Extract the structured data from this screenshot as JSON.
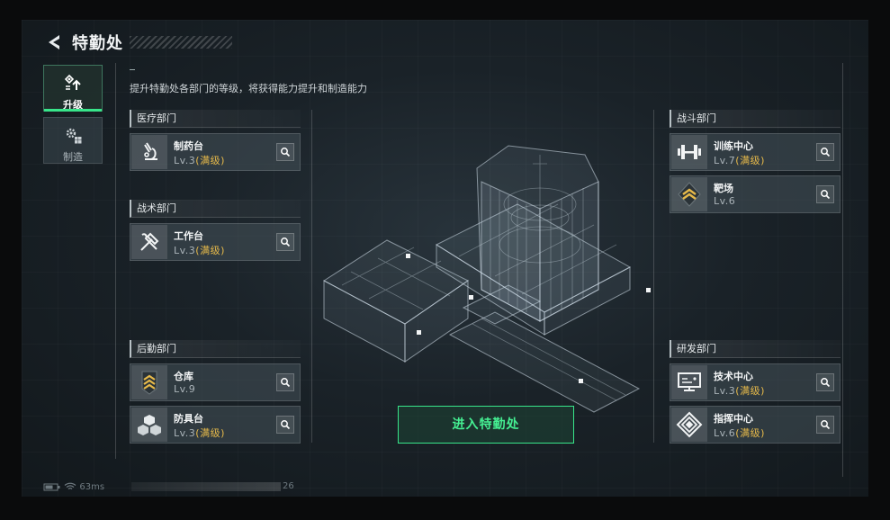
{
  "header": {
    "title": "特勤处"
  },
  "tabs": [
    {
      "label": "升级",
      "icon": "upgrade-icon",
      "active": true
    },
    {
      "label": "制造",
      "icon": "gears-icon",
      "active": false
    }
  ],
  "description": "提升特勤处各部门的等级，将获得能力提升和制造能力",
  "colors": {
    "accent": "#38e58a",
    "max_level": "#e6b94a"
  },
  "departments": {
    "medical": {
      "title": "医疗部门",
      "items": [
        {
          "name": "制药台",
          "level": "Lv.3",
          "max": "(满级)",
          "icon": "microscope-icon"
        }
      ]
    },
    "tactical": {
      "title": "战术部门",
      "items": [
        {
          "name": "工作台",
          "level": "Lv.3",
          "max": "(满级)",
          "icon": "tools-icon"
        }
      ]
    },
    "logistics": {
      "title": "后勤部门",
      "items": [
        {
          "name": "仓库",
          "level": "Lv.9",
          "icon": "rank-chevron-icon"
        },
        {
          "name": "防具台",
          "level": "Lv.3",
          "max": "(满级)",
          "icon": "cubes-icon"
        }
      ]
    },
    "combat": {
      "title": "战斗部门",
      "items": [
        {
          "name": "训练中心",
          "level": "Lv.7",
          "max": "(满级)",
          "icon": "dumbbell-icon"
        },
        {
          "name": "靶场",
          "level": "Lv.6",
          "icon": "rank-badge-icon"
        }
      ]
    },
    "research": {
      "title": "研发部门",
      "items": [
        {
          "name": "技术中心",
          "level": "Lv.3",
          "max": "(满级)",
          "icon": "monitor-icon"
        },
        {
          "name": "指挥中心",
          "level": "Lv.6",
          "max": "(满级)",
          "icon": "emblem-icon"
        }
      ]
    }
  },
  "enter_button": "进入特勤处",
  "status": {
    "ping": "63ms",
    "value": "26"
  }
}
